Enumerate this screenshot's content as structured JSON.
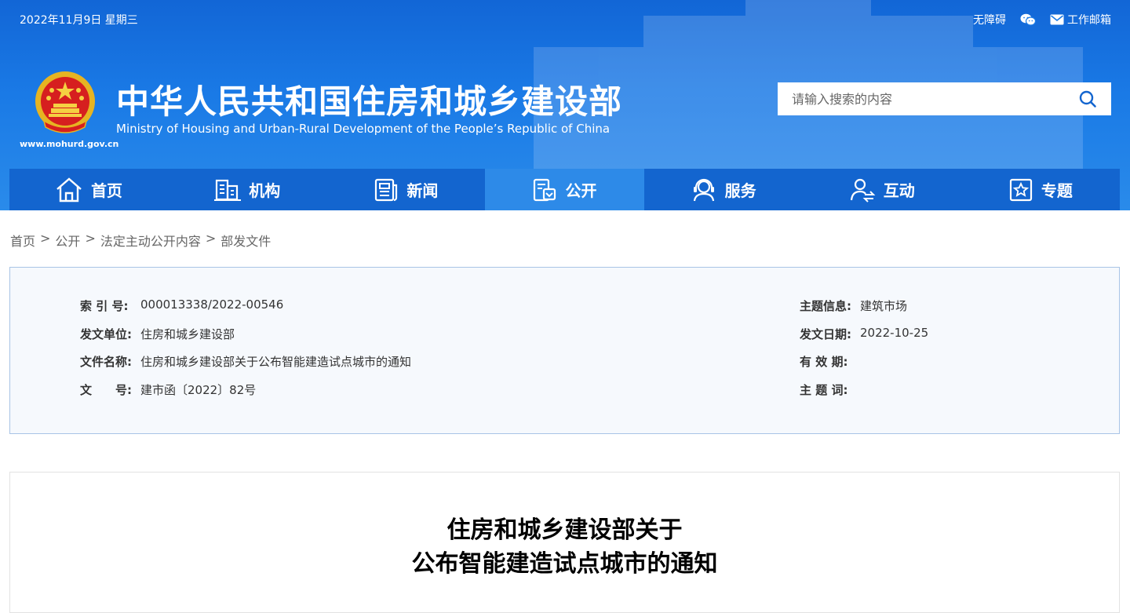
{
  "topbar": {
    "date": "2022年11月9日 星期三",
    "accessibility": "无障碍",
    "wechat_icon": "wechat-icon",
    "mail_icon": "mail-icon",
    "work_mail": "工作邮箱"
  },
  "brand": {
    "title": "中华人民共和国住房和城乡建设部",
    "subtitle": "Ministry of Housing and Urban-Rural Development of the People’s Republic of China",
    "url": "www.mohurd.gov.cn",
    "emblem_icon": "national-emblem-icon"
  },
  "search": {
    "placeholder": "请输入搜索的内容",
    "icon": "search-icon"
  },
  "nav": {
    "items": [
      {
        "label": "首页",
        "icon": "home-icon"
      },
      {
        "label": "机构",
        "icon": "building-icon"
      },
      {
        "label": "新闻",
        "icon": "news-icon"
      },
      {
        "label": "公开",
        "icon": "disclosure-icon",
        "active": true
      },
      {
        "label": "服务",
        "icon": "service-icon"
      },
      {
        "label": "互动",
        "icon": "interaction-icon"
      },
      {
        "label": "专题",
        "icon": "topic-star-icon"
      }
    ]
  },
  "breadcrumb": {
    "items": [
      "首页",
      "公开",
      "法定主动公开内容",
      "部发文件"
    ],
    "separator": ">"
  },
  "info": {
    "index_label": "索 引 号:",
    "index_value": "000013338/2022-00546",
    "topic_label": "主题信息:",
    "topic_value": "建筑市场",
    "issuer_label": "发文单位:",
    "issuer_value": "住房和城乡建设部",
    "date_label": "发文日期:",
    "date_value": "2022-10-25",
    "name_label": "文件名称:",
    "name_value": "住房和城乡建设部关于公布智能建造试点城市的通知",
    "valid_label": "有 效 期:",
    "valid_value": "",
    "doc_no_label": "文　　号:",
    "doc_no_value": "建市函〔2022〕82号",
    "keywords_label": "主 题 词:",
    "keywords_value": ""
  },
  "article": {
    "title_line1": "住房和城乡建设部关于",
    "title_line2": "公布智能建造试点城市的通知"
  },
  "colors": {
    "header_blue": "#1a7ae6",
    "nav_blue": "#1365cf",
    "nav_active": "#2d8ae8",
    "info_bg": "#f6f9fd",
    "info_border": "#a8c4e6"
  }
}
